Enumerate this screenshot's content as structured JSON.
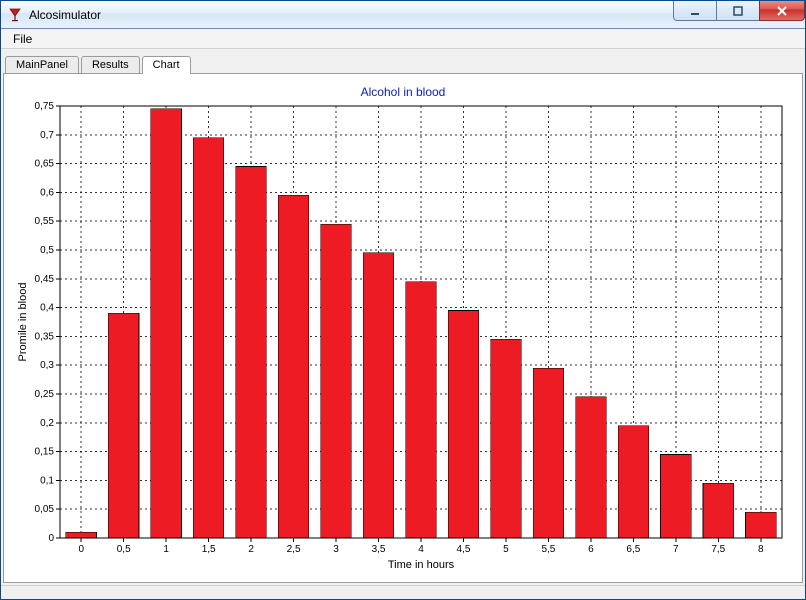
{
  "window": {
    "title": "Alcosimulator"
  },
  "menubar": {
    "file": "File"
  },
  "tabs": {
    "main": "MainPanel",
    "results": "Results",
    "chart": "Chart"
  },
  "chart_data": {
    "type": "bar",
    "title": "Alcohol in blood",
    "xlabel": "Time in hours",
    "ylabel": "Promile in blood",
    "ylim": [
      0,
      0.75
    ],
    "ytick_step": 0.05,
    "categories": [
      "0",
      "0,5",
      "1",
      "1,5",
      "2",
      "2,5",
      "3",
      "3,5",
      "4",
      "4,5",
      "5",
      "5,5",
      "6",
      "6,5",
      "7",
      "7,5",
      "8"
    ],
    "values": [
      0.01,
      0.39,
      0.745,
      0.695,
      0.645,
      0.595,
      0.545,
      0.495,
      0.445,
      0.395,
      0.345,
      0.295,
      0.245,
      0.195,
      0.145,
      0.095,
      0.045
    ]
  }
}
